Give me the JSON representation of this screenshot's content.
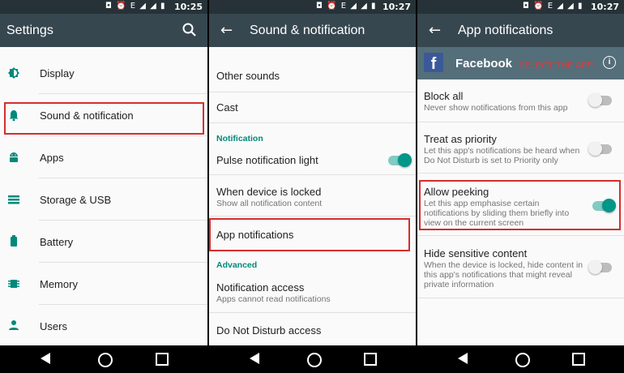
{
  "status_bar": {
    "panel1_time": "10:25",
    "panel2_time": "10:27",
    "panel3_time": "10:27",
    "icons": "◘ ⏰ E ◢ ◢ ▮",
    "bg_color": "#263238"
  },
  "panel1": {
    "title": "Settings",
    "items": [
      {
        "label": "Display",
        "icon": "brightness-icon"
      },
      {
        "label": "Sound & notification",
        "icon": "bell-icon"
      },
      {
        "label": "Apps",
        "icon": "android-icon"
      },
      {
        "label": "Storage & USB",
        "icon": "storage-icon"
      },
      {
        "label": "Battery",
        "icon": "battery-icon"
      },
      {
        "label": "Memory",
        "icon": "memory-icon"
      },
      {
        "label": "Users",
        "icon": "user-icon"
      }
    ]
  },
  "panel2": {
    "title": "Sound & notification",
    "other_sounds": "Other sounds",
    "cast": "Cast",
    "notification_header": "Notification",
    "pulse_light": "Pulse notification light",
    "pulse_light_on": true,
    "when_locked": "When device is locked",
    "when_locked_sub": "Show all notification content",
    "app_notifications": "App notifications",
    "advanced_header": "Advanced",
    "notification_access": "Notification access",
    "notification_access_sub": "Apps cannot read notifications",
    "do_not_disturb": "Do Not Disturb access"
  },
  "panel3": {
    "title": "App notifications",
    "app_name": "Facebook",
    "annotation": "SELECT THE APP",
    "block_all": "Block all",
    "block_all_sub": "Never show notifications from this app",
    "block_all_on": false,
    "priority": "Treat as priority",
    "priority_sub_1": "Let this app's notifications be heard when",
    "priority_sub_2": "Do Not Disturb is set to Priority only",
    "priority_on": false,
    "peeking": "Allow peeking",
    "peeking_sub_1": "Let this app emphasise certain",
    "peeking_sub_2": "notifications by sliding them briefly into",
    "peeking_sub_3": "view on the current screen",
    "peeking_on": true,
    "sensitive": "Hide sensitive content",
    "sensitive_sub_1": "When the device is locked, hide content in",
    "sensitive_sub_2": "this app's notifications that might reveal",
    "sensitive_sub_3": "private information",
    "sensitive_on": false
  },
  "colors": {
    "accent": "#009688",
    "appbar": "#37474f",
    "highlight": "#d32f2f"
  }
}
